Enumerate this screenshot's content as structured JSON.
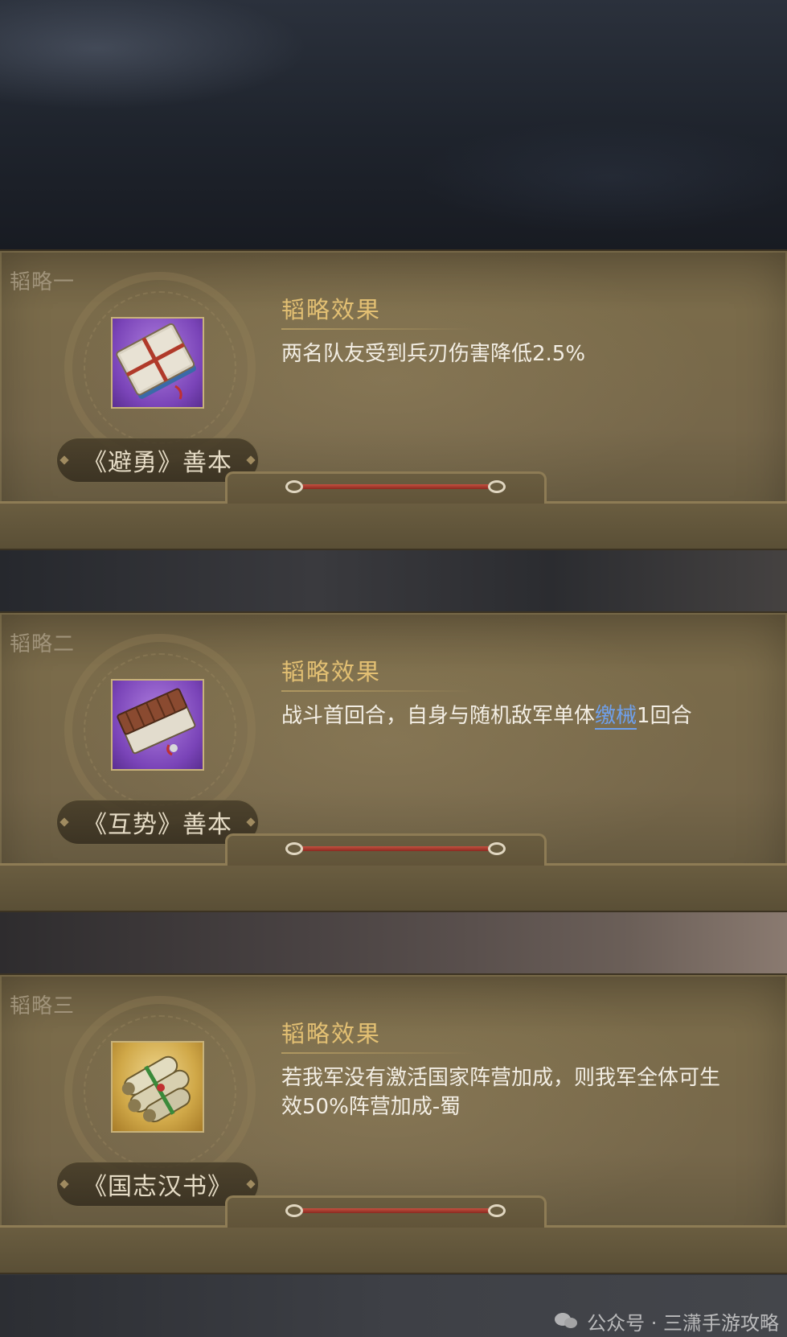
{
  "strategies": [
    {
      "section_label": "韬略一",
      "effect_title": "韬略效果",
      "book_name": "《避勇》善本",
      "icon": "purple-manuscript-book-icon",
      "effect_parts": [
        {
          "text": "两名队友受到兵刃伤害降低2.5%"
        }
      ]
    },
    {
      "section_label": "韬略二",
      "effect_title": "韬略效果",
      "book_name": "《互势》善本",
      "icon": "purple-bamboo-book-icon",
      "effect_parts": [
        {
          "text": "战斗首回合，自身与随机敌军单体"
        },
        {
          "text": "缴械",
          "keyword": true
        },
        {
          "text": "1回合"
        }
      ]
    },
    {
      "section_label": "韬略三",
      "effect_title": "韬略效果",
      "book_name": "《国志汉书》",
      "icon": "gold-scroll-bundle-icon",
      "effect_parts": [
        {
          "text": "若我军没有激活国家阵营加成，则我军全体可生效50%阵营加成-蜀"
        }
      ]
    }
  ],
  "watermark": {
    "text": "公众号 · 三潇手游攻略",
    "icon": "wechat-icon"
  },
  "colors": {
    "effect_title": "#e3c073",
    "keyword": "#6fa0ec",
    "panel": "#76674a"
  }
}
